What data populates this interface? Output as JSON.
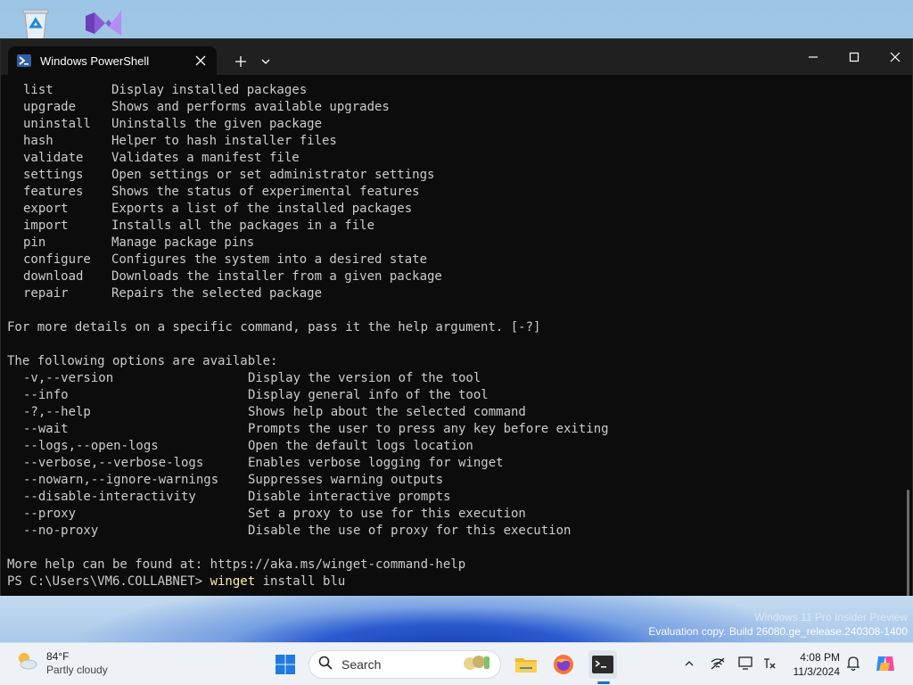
{
  "window": {
    "tab_title": "Windows PowerShell"
  },
  "commands": [
    {
      "name": "list",
      "desc": "Display installed packages"
    },
    {
      "name": "upgrade",
      "desc": "Shows and performs available upgrades"
    },
    {
      "name": "uninstall",
      "desc": "Uninstalls the given package"
    },
    {
      "name": "hash",
      "desc": "Helper to hash installer files"
    },
    {
      "name": "validate",
      "desc": "Validates a manifest file"
    },
    {
      "name": "settings",
      "desc": "Open settings or set administrator settings"
    },
    {
      "name": "features",
      "desc": "Shows the status of experimental features"
    },
    {
      "name": "export",
      "desc": "Exports a list of the installed packages"
    },
    {
      "name": "import",
      "desc": "Installs all the packages in a file"
    },
    {
      "name": "pin",
      "desc": "Manage package pins"
    },
    {
      "name": "configure",
      "desc": "Configures the system into a desired state"
    },
    {
      "name": "download",
      "desc": "Downloads the installer from a given package"
    },
    {
      "name": "repair",
      "desc": "Repairs the selected package"
    }
  ],
  "details_line": "For more details on a specific command, pass it the help argument. [-?]",
  "options_header": "The following options are available:",
  "options": [
    {
      "name": "-v,--version",
      "desc": "Display the version of the tool"
    },
    {
      "name": "--info",
      "desc": "Display general info of the tool"
    },
    {
      "name": "-?,--help",
      "desc": "Shows help about the selected command"
    },
    {
      "name": "--wait",
      "desc": "Prompts the user to press any key before exiting"
    },
    {
      "name": "--logs,--open-logs",
      "desc": "Open the default logs location"
    },
    {
      "name": "--verbose,--verbose-logs",
      "desc": "Enables verbose logging for winget"
    },
    {
      "name": "--nowarn,--ignore-warnings",
      "desc": "Suppresses warning outputs"
    },
    {
      "name": "--disable-interactivity",
      "desc": "Disable interactive prompts"
    },
    {
      "name": "--proxy",
      "desc": "Set a proxy to use for this execution"
    },
    {
      "name": "--no-proxy",
      "desc": "Disable the use of proxy for this execution"
    }
  ],
  "help_line": "More help can be found at: https://aka.ms/winget-command-help",
  "prompt": {
    "path": "PS C:\\Users\\VM6.COLLABNET> ",
    "command": "winget",
    "args": " install blu"
  },
  "watermark": {
    "line1": "Windows 11 Pro Insider Preview",
    "line2": "Evaluation copy. Build 26080.ge_release.240308-1400"
  },
  "taskbar": {
    "temperature": "84°F",
    "condition": "Partly cloudy",
    "search_label": "Search",
    "time": "4:08 PM",
    "date": "11/3/2024"
  },
  "colors": {
    "console_bg": "#0c0c0c",
    "console_text": "#cccccc",
    "command_highlight": "#f9f1a5",
    "titlebar": "#202020"
  },
  "icons": [
    "recycle-bin-icon",
    "visual-studio-icon",
    "powershell-icon",
    "close-icon",
    "plus-icon",
    "chevron-down-icon",
    "minimize-icon",
    "maximize-icon",
    "weather-icon",
    "windows-start-icon",
    "search-icon",
    "file-explorer-icon",
    "firefox-icon",
    "terminal-icon",
    "chevron-up-icon",
    "network-icon",
    "display-icon",
    "accessibility-icon",
    "bell-icon",
    "copilot-icon"
  ]
}
